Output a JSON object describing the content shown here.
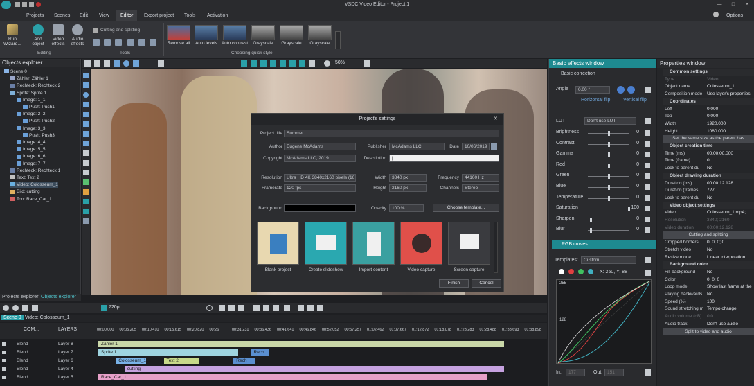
{
  "window": {
    "title": "VSDC Video Editor - Project 1"
  },
  "menu": {
    "items": [
      "Projects",
      "Scenes",
      "Edit",
      "View",
      "Editor",
      "Export project",
      "Tools",
      "Activation"
    ],
    "active": "Editor",
    "options": "Options"
  },
  "ribbon": {
    "run_wizard": "Run Wizard...",
    "add_object": "Add object",
    "video_effects": "Video effects",
    "audio_effects": "Audio effects",
    "editing_label": "Editing",
    "cutting_label": "Cutting and splitting",
    "tools_label": "Tools",
    "styles": [
      "Remove all",
      "Auto levels",
      "Auto contrast",
      "Grayscale",
      "Grayscale",
      "Grayscale"
    ],
    "styles_label": "Choosing quick style"
  },
  "objects_explorer": {
    "title": "Objects explorer",
    "items": [
      {
        "label": "Scene 0",
        "depth": 0,
        "color": "#8ab4e6"
      },
      {
        "label": "Zähler: Zähler 1",
        "depth": 1,
        "color": "#9aa6c8"
      },
      {
        "label": "Rechteck: Rechteck 2",
        "depth": 1,
        "color": "#6a7fa6"
      },
      {
        "label": "Sprite: Sprite 1",
        "depth": 1,
        "color": "#7fb0d8"
      },
      {
        "label": "Image: 1_1",
        "depth": 2,
        "color": "#6a9fd8"
      },
      {
        "label": "Push: Push1",
        "depth": 3,
        "color": "#6a9fd8"
      },
      {
        "label": "Image: 2_2",
        "depth": 2,
        "color": "#6a9fd8"
      },
      {
        "label": "Push: Push2",
        "depth": 3,
        "color": "#6a9fd8"
      },
      {
        "label": "Image: 3_3",
        "depth": 2,
        "color": "#6a9fd8"
      },
      {
        "label": "Push: Push3",
        "depth": 3,
        "color": "#6a9fd8"
      },
      {
        "label": "Image: 4_4",
        "depth": 2,
        "color": "#6a9fd8"
      },
      {
        "label": "Image: 5_5",
        "depth": 2,
        "color": "#6a9fd8"
      },
      {
        "label": "Image: 6_6",
        "depth": 2,
        "color": "#6a9fd8"
      },
      {
        "label": "Image: 7_7",
        "depth": 2,
        "color": "#6a9fd8"
      },
      {
        "label": "Rechteck: Rechteck 1",
        "depth": 1,
        "color": "#6a7fa6"
      },
      {
        "label": "Text: Text 2",
        "depth": 1,
        "color": "#c0c0c0"
      },
      {
        "label": "Video: Colosseum_1",
        "depth": 1,
        "color": "#6ab0e0"
      },
      {
        "label": "Bild: cutting",
        "depth": 1,
        "color": "#e0b060"
      },
      {
        "label": "Ton: Race_Car_1",
        "depth": 1,
        "color": "#d06060"
      }
    ],
    "tabs": [
      "Projects explorer",
      "Objects explorer"
    ]
  },
  "preview": {
    "zoom": "50%"
  },
  "dialog": {
    "title": "Project's settings",
    "project_title_label": "Project title",
    "project_title": "Summer",
    "author_label": "Author",
    "author": "Eugene McAdams",
    "publisher_label": "Publisher",
    "publisher": "McAdams LLC",
    "date_label": "Date",
    "date": "10/06/2019",
    "copyright_label": "Copyright",
    "copyright": "McAdams LLC, 2019",
    "description_label": "Description",
    "description": "|",
    "resolution_label": "Resolution",
    "resolution": "Ultra HD 4K 3840x2160 pixels (16",
    "width_label": "Width",
    "width": "3840 px",
    "frequency_label": "Frequency",
    "frequency": "44100 Hz",
    "framerate_label": "Framerate",
    "framerate": "120 fps",
    "height_label": "Height",
    "height": "2160 px",
    "channels_label": "Channels",
    "channels": "Stereo",
    "background_label": "Background",
    "opacity_label": "Opacity",
    "opacity": "100 %",
    "choose_template": "Choose template...",
    "tiles": [
      "Blank project",
      "Create slideshow",
      "Import content",
      "Video capture",
      "Screen capture"
    ],
    "finish": "Finish",
    "cancel": "Cancel"
  },
  "basic_effects": {
    "title": "Basic effects window",
    "basic_correction": "Basic correction",
    "angle_label": "Angle",
    "angle": "0.00 °",
    "horizontal_flip": "Horizontal flip",
    "vertical_flip": "Vertical flip",
    "lut_label": "LUT",
    "lut": "Don't use LUT",
    "sliders": [
      {
        "label": "Brightness",
        "value": "0",
        "pos": 0.5
      },
      {
        "label": "Contrast",
        "value": "0",
        "pos": 0.5
      },
      {
        "label": "Gamma",
        "value": "0",
        "pos": 0.5
      },
      {
        "label": "Red",
        "value": "0",
        "pos": 0.5
      },
      {
        "label": "Green",
        "value": "0",
        "pos": 0.5
      },
      {
        "label": "Blue",
        "value": "0",
        "pos": 0.5
      },
      {
        "label": "Temperature",
        "value": "0",
        "pos": 0.5
      },
      {
        "label": "Saturation",
        "value": "100",
        "pos": 1.0
      },
      {
        "label": "Sharpen",
        "value": "0",
        "pos": 0.05
      },
      {
        "label": "Blur",
        "value": "0",
        "pos": 0.05
      }
    ],
    "rgb_curves": "RGB curves",
    "templates_label": "Templates:",
    "template": "Custom",
    "coords": "X: 250, Y: 88",
    "curve_top": "255",
    "curve_mid": "128",
    "in_label": "In:",
    "in_value": "177",
    "out_label": "Out:",
    "out_value": "151"
  },
  "properties": {
    "title": "Properties window",
    "rows": [
      {
        "k": "Common settings",
        "v": "",
        "type": "sec"
      },
      {
        "k": "Type",
        "v": "Video",
        "type": "dim"
      },
      {
        "k": "Object name",
        "v": "Colosseum_1",
        "type": "row"
      },
      {
        "k": "Composition mode",
        "v": "Use layer's properties",
        "type": "row"
      },
      {
        "k": "Coordinates",
        "v": "",
        "type": "sec"
      },
      {
        "k": "Left",
        "v": "0.000",
        "type": "row"
      },
      {
        "k": "Top",
        "v": "0.000",
        "type": "row"
      },
      {
        "k": "Width",
        "v": "1920.000",
        "type": "row"
      },
      {
        "k": "Height",
        "v": "1080.000",
        "type": "row"
      },
      {
        "k": "Set the same size as the parent has",
        "v": "",
        "type": "btn"
      },
      {
        "k": "Object creation time",
        "v": "",
        "type": "sec"
      },
      {
        "k": "Time (ms)",
        "v": "00:00:00.000",
        "type": "row"
      },
      {
        "k": "Time (frame)",
        "v": "0",
        "type": "row"
      },
      {
        "k": "Lock to parent du",
        "v": "No",
        "type": "row"
      },
      {
        "k": "Object drawing duration",
        "v": "",
        "type": "sec"
      },
      {
        "k": "Duration (ms)",
        "v": "00:00:12.128",
        "type": "row"
      },
      {
        "k": "Duration (frames",
        "v": "727",
        "type": "row"
      },
      {
        "k": "Lock to parent du",
        "v": "No",
        "type": "row"
      },
      {
        "k": "Video object settings",
        "v": "",
        "type": "sec"
      },
      {
        "k": "Video",
        "v": "Colosseum_1.mp4;",
        "type": "row"
      },
      {
        "k": "Resolution",
        "v": "3840; 2160",
        "type": "dim"
      },
      {
        "k": "Video duration",
        "v": "00:00:12.128",
        "type": "dim"
      },
      {
        "k": "Cutting and splitting",
        "v": "",
        "type": "btn"
      },
      {
        "k": "Cropped borders",
        "v": "0; 0; 0; 0",
        "type": "row"
      },
      {
        "k": "Stretch video",
        "v": "No",
        "type": "row"
      },
      {
        "k": "Resize mode",
        "v": "Linear interpolation",
        "type": "row"
      },
      {
        "k": "Background color",
        "v": "",
        "type": "sec"
      },
      {
        "k": "Fill background",
        "v": "No",
        "type": "row"
      },
      {
        "k": "Color",
        "v": "0; 0; 0",
        "type": "row"
      },
      {
        "k": "Loop mode",
        "v": "Show last frame at the",
        "type": "row"
      },
      {
        "k": "Playing backwards",
        "v": "No",
        "type": "row"
      },
      {
        "k": "Speed (%)",
        "v": "100",
        "type": "row"
      },
      {
        "k": "Sound stretching m",
        "v": "Tempo change",
        "type": "row"
      },
      {
        "k": "Audio volume (dB)",
        "v": "0.0",
        "type": "dim"
      },
      {
        "k": "Audio track",
        "v": "Don't use audio",
        "type": "row"
      },
      {
        "k": "Split to video and audio",
        "v": "",
        "type": "btn"
      }
    ]
  },
  "timeline": {
    "resolution": "720p",
    "tabs": [
      "Scene 0",
      "Video: Colosseum_1"
    ],
    "com": "COM...",
    "layers_label": "LAYERS",
    "ruler": [
      "00:00.000",
      "00:05.205",
      "00:10.410",
      "00:15.615",
      "00:20.820",
      "00:26",
      "00:31.231",
      "00:36.436",
      "00:41.641",
      "00:46.846",
      "00:52.052",
      "00:57.257",
      "01:02.462",
      "01:07.667",
      "01:12.872",
      "01:18.078",
      "01:23.283",
      "01:28.488",
      "01:33.693",
      "01:38.898"
    ],
    "layers": [
      {
        "blend": "Blend",
        "name": "Layer 8"
      },
      {
        "blend": "Blend",
        "name": "Layer 7"
      },
      {
        "blend": "Blend",
        "name": "Layer 6"
      },
      {
        "blend": "Blend",
        "name": "Layer 4"
      },
      {
        "blend": "Blend",
        "name": "Layer 5"
      }
    ],
    "clips": [
      {
        "label": "Zähler 1",
        "row": 0,
        "start": 0.0,
        "end": 0.93,
        "color": "#c9d7a8"
      },
      {
        "label": "Sprite 1",
        "row": 1,
        "start": 0.0,
        "end": 0.32,
        "color": "#9fd4e0"
      },
      {
        "label": "Rech",
        "row": 1,
        "start": 0.35,
        "end": 0.39,
        "color": "#5a8fd0"
      },
      {
        "label": "Colosseum_1",
        "row": 2,
        "start": 0.04,
        "end": 0.11,
        "color": "#79b3e8"
      },
      {
        "label": "Text 2",
        "row": 2,
        "start": 0.15,
        "end": 0.23,
        "color": "#c7d98a"
      },
      {
        "label": "Rech",
        "row": 2,
        "start": 0.31,
        "end": 0.36,
        "color": "#5a8fd0"
      },
      {
        "label": "cutting",
        "row": 3,
        "start": 0.06,
        "end": 0.93,
        "color": "#c6a2e0"
      },
      {
        "label": "Race_Car_1",
        "row": 4,
        "start": 0.0,
        "end": 0.89,
        "color": "#e6a0c8"
      }
    ]
  },
  "colors": {
    "accent": "#2aa0a8",
    "panel": "#2c2d30",
    "header": "#2a2b2e"
  }
}
